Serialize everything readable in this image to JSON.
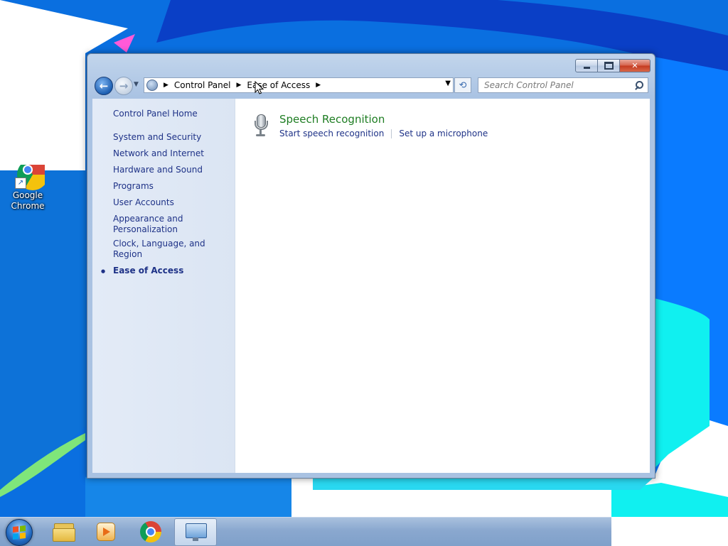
{
  "desktop": {
    "icons": [
      {
        "label": "Google Chrome",
        "icon": "chrome-icon"
      }
    ]
  },
  "window": {
    "caption_buttons": {
      "minimize": "minimize-icon",
      "maximize": "maximize-icon",
      "close": "close-icon"
    },
    "address_bar": {
      "crumbs": [
        "Control Panel",
        "Ease of Access"
      ]
    },
    "search": {
      "placeholder": "Search Control Panel"
    },
    "left_nav": {
      "home": "Control Panel Home",
      "items": [
        "System and Security",
        "Network and Internet",
        "Hardware and Sound",
        "Programs",
        "User Accounts",
        "Appearance and Personalization",
        "Clock, Language, and Region"
      ],
      "current": "Ease of Access"
    },
    "main": {
      "section_title": "Speech Recognition",
      "section_icon": "microphone-icon",
      "links": [
        "Start speech recognition",
        "Set up a microphone"
      ]
    }
  },
  "taskbar": {
    "items": [
      {
        "name": "windows-explorer",
        "icon": "folder-icon",
        "active": false
      },
      {
        "name": "media-player",
        "icon": "media-player-icon",
        "active": false
      },
      {
        "name": "google-chrome",
        "icon": "chrome-icon",
        "active": false
      },
      {
        "name": "control-panel",
        "icon": "control-panel-icon",
        "active": true
      }
    ]
  },
  "colors": {
    "link": "#1e3287",
    "section_title": "#1e7d22",
    "nav_pane": "#dbe5f3",
    "taskbar": "#8aa8cf"
  }
}
